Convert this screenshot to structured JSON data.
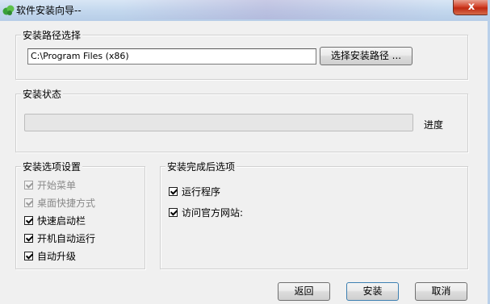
{
  "window": {
    "title": "软件安装向导--",
    "close_symbol": "x"
  },
  "install_path": {
    "group_title": "安装路径选择",
    "path_value": "C:\\Program Files (x86)",
    "browse_button": "选择安装路径 ..."
  },
  "install_status": {
    "group_title": "安装状态",
    "progress_percent": 0,
    "progress_label": "进度"
  },
  "install_options": {
    "group_title": "安装选项设置",
    "items": [
      {
        "label": "开始菜单",
        "checked": true,
        "enabled": false
      },
      {
        "label": "桌面快捷方式",
        "checked": true,
        "enabled": false
      },
      {
        "label": "快速启动栏",
        "checked": true,
        "enabled": true
      },
      {
        "label": "开机自动运行",
        "checked": true,
        "enabled": true
      },
      {
        "label": "自动升级",
        "checked": true,
        "enabled": true
      }
    ]
  },
  "post_install": {
    "group_title": "安装完成后选项",
    "items": [
      {
        "label": "运行程序",
        "checked": true,
        "enabled": true
      },
      {
        "label": "访问官方网站:",
        "checked": true,
        "enabled": true
      }
    ]
  },
  "footer": {
    "back_button": "返回",
    "install_button": "安装",
    "cancel_button": "取消"
  },
  "colors": {
    "progress_fill": "#06b025",
    "title_bar": "#c4d8ee",
    "close_button": "#d2442c"
  }
}
